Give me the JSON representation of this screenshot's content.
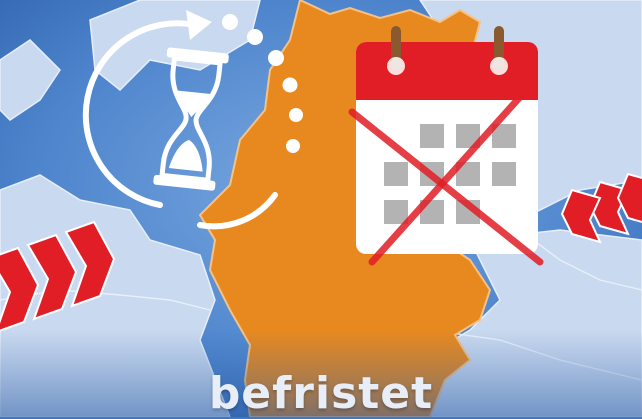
{
  "caption": {
    "text": "befristet"
  },
  "icons": {
    "timer": "hourglass-refresh-icon",
    "calendar": "crossed-out-calendar-icon",
    "arrows_left": "red-chevron-arrows-icon",
    "arrows_right": "red-chevron-arrows-icon"
  },
  "colors": {
    "background": "#3f78c4",
    "land": "#d7e4f4",
    "germany": "#e8891f",
    "accent_red": "#e11d25",
    "white": "#ffffff"
  }
}
